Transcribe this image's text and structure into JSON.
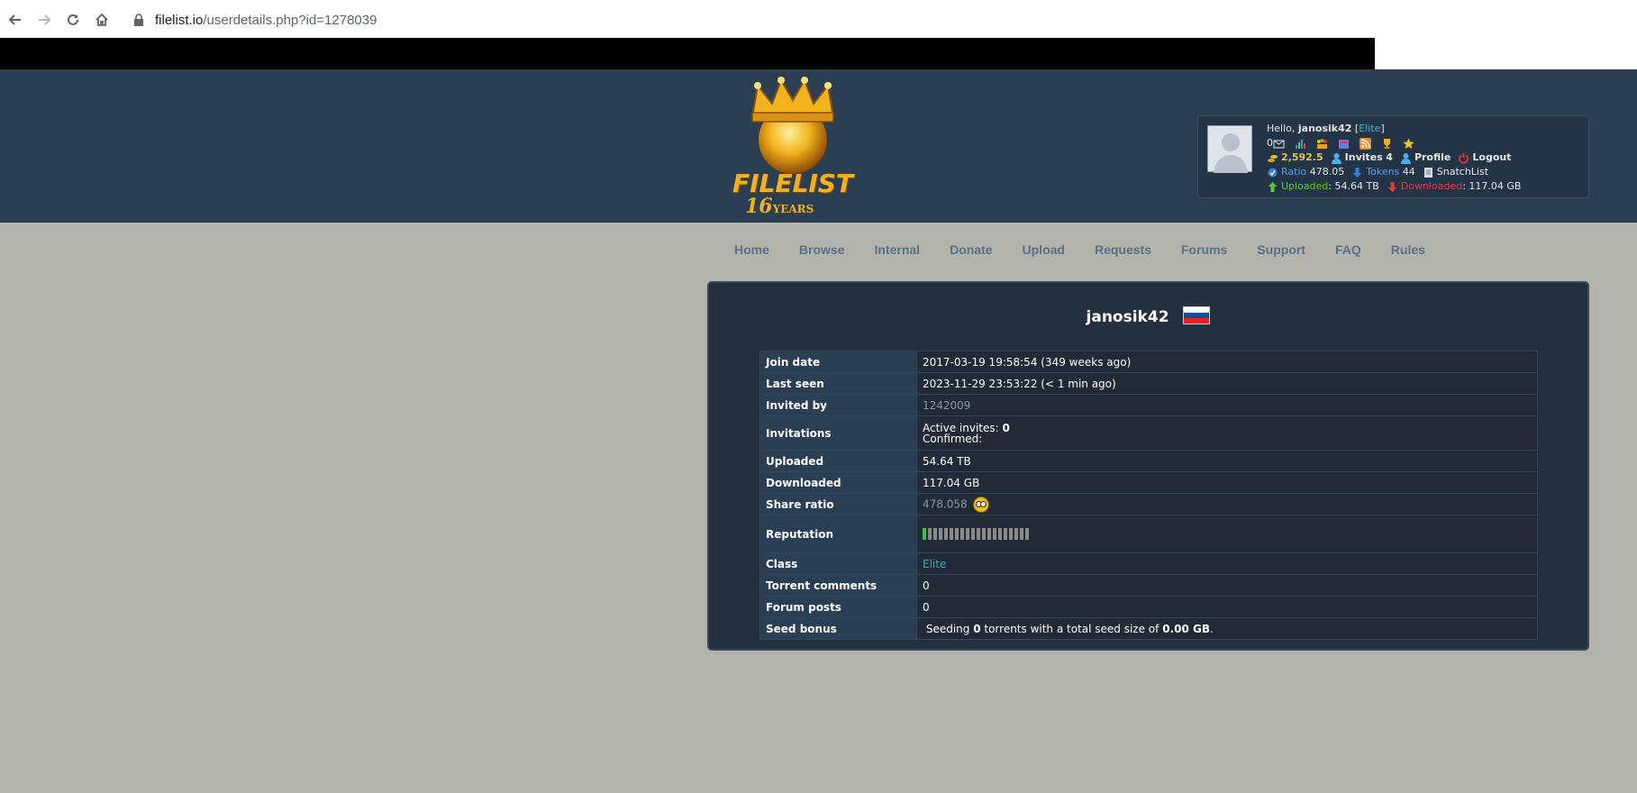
{
  "browser": {
    "url_host": "filelist.io",
    "url_path": "/userdetails.php?id=1278039",
    "back_icon": "arrow-left-icon",
    "forward_icon": "arrow-right-icon",
    "reload_icon": "reload-icon",
    "home_icon": "home-icon",
    "lock_icon": "lock-icon"
  },
  "logo": {
    "name": "FILELIST",
    "years_num": "16",
    "years_word": "YEARS"
  },
  "userbox": {
    "hello": "Hello,",
    "username": "janosik42",
    "class_open": "[",
    "class": "Elite",
    "class_close": "]",
    "messages": "0",
    "bonus": "2,592.5",
    "invites_label": "Invites",
    "invites_count": "4",
    "profile_label": "Profile",
    "logout_label": "Logout",
    "ratio_label": "Ratio",
    "ratio_value": "478.05",
    "tokens_label": "Tokens",
    "tokens_value": "44",
    "snatchlist_label": "SnatchList",
    "uploaded_label": "Uploaded",
    "uploaded_value": ": 54.64 TB",
    "downloaded_label": "Downloaded",
    "downloaded_value": ": 117.04 GB"
  },
  "nav": [
    "Home",
    "Browse",
    "Internal",
    "Donate",
    "Upload",
    "Requests",
    "Forums",
    "Support",
    "FAQ",
    "Rules"
  ],
  "profile": {
    "name": "janosik42",
    "rows": {
      "join_label": "Join date",
      "join_value": "2017-03-19 19:58:54 (349 weeks ago)",
      "seen_label": "Last seen",
      "seen_value": "2023-11-29 23:53:22 (< 1 min ago)",
      "invited_label": "Invited by",
      "invited_value": "1242009",
      "invitations_label": "Invitations",
      "active_invites_label": "Active invites: ",
      "active_invites_value": "0",
      "confirmed_label": "Confirmed:",
      "uploaded_label": "Uploaded",
      "uploaded_value": "54.64 TB",
      "downloaded_label": "Downloaded",
      "downloaded_value": "117.04 GB",
      "ratio_label": "Share ratio",
      "ratio_value": "478.058",
      "reputation_label": "Reputation",
      "reputation_level": 0.05,
      "class_label": "Class",
      "class_value": "Elite",
      "comments_label": "Torrent comments",
      "comments_value": "0",
      "posts_label": "Forum posts",
      "posts_value": "0",
      "seed_label": "Seed bonus",
      "seed_pre": "Seeding ",
      "seed_count": "0",
      "seed_mid": " torrents with a total seed size of ",
      "seed_size": "0.00 GB",
      "seed_end": "."
    }
  },
  "colors": {
    "header_bg": "#2b3e52",
    "page_bg": "#b2b3aa",
    "panel_bg": "#24303d",
    "accent_cyan": "#39a9b8",
    "flag_white": "#ffffff",
    "flag_blue": "#0b4ea2",
    "flag_red": "#ee1c25"
  }
}
